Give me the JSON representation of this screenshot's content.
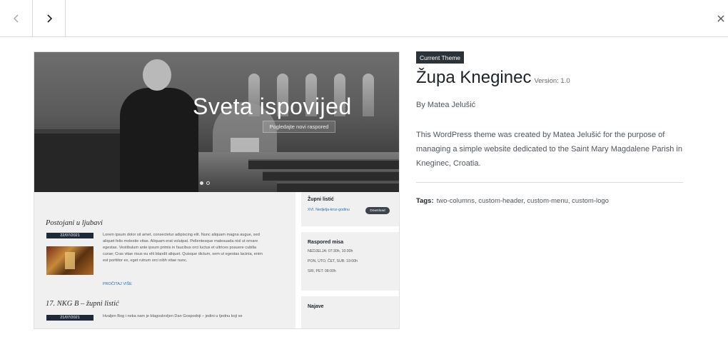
{
  "nav": {
    "prev_icon": "chevron-left-icon",
    "next_icon": "chevron-right-icon",
    "close_icon": "close-icon"
  },
  "screenshot": {
    "hero": {
      "title": "Sveta ispovijed",
      "button": "Pogledajte novi raspored"
    },
    "posts": [
      {
        "title": "Postojani u ljubavi",
        "date": "22/07/2021",
        "excerpt": "Lorem ipsum dolor sit amet, consectetur adipiscing elit. Nunc aliquam magna augue, sed aliquet felis molestie vitae. Aliquam erat volutpat. Pellentesque malesuada nisl ut ornare egestas. Vestibulum ante ipsum primis in faucibus orci luctus et ultrices posuere cubilia curae; Cras vitae risus eu elit blandit aliquet. Quisque dictum, sem ut egestas lacinia, enim est porttitor ex, eget rutrum orci nibh vitae nunc.",
        "more": "PROČITAJ VIŠE"
      },
      {
        "title": "17. NKG B – župni listić",
        "date": "21/07/2021",
        "excerpt": "Hvaljen Bog i neka nam je blagoslovljen Dan Gospodnji – jedini u tjednu koji se"
      }
    ],
    "sidebar": {
      "leaflet": {
        "title": "Župni listić",
        "link": "XVI. Nedjelja-kroz-godinu",
        "button": "Download"
      },
      "mass": {
        "title": "Raspored misa",
        "rows": [
          "NEDJELJA: 07:30h, 10:30h",
          "PON, UTO, ČET, SUB: 19:00h",
          "SRI, PET: 08:00h"
        ]
      },
      "news": {
        "title": "Najave"
      }
    }
  },
  "theme": {
    "badge": "Current Theme",
    "name": "Župa Kneginec",
    "version": "Version: 1.0",
    "author": "By Matea Jelušić",
    "description": "This WordPress theme was created by Matea Jelušić for the purpose of managing a simple website dedicated to the Saint Mary Magdalene Parish in Kneginec, Croatia.",
    "tags_label": "Tags:",
    "tags": "two-columns, custom-header, custom-menu, custom-logo"
  }
}
